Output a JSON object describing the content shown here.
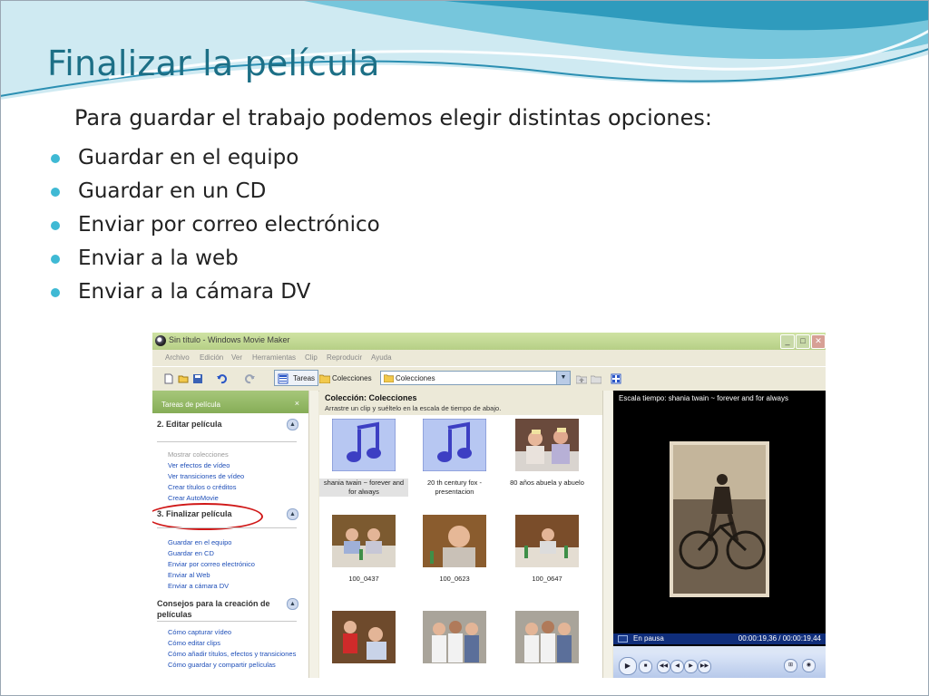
{
  "slide": {
    "title": "Finalizar la película",
    "intro": "Para guardar el trabajo podemos elegir distintas opciones:",
    "bullets": [
      "Guardar en el equipo",
      "Guardar en un CD",
      "Enviar por correo electrónico",
      "Enviar a la web",
      "Enviar a la cámara DV"
    ],
    "colors": {
      "title": "#1c6f86",
      "bullet_dot": "#3fb9d4",
      "highlight_oval": "#d01818"
    }
  },
  "window": {
    "title": "Sin título - Windows Movie Maker",
    "controls": {
      "minimize": "_",
      "maximize": "□",
      "close": "✕"
    },
    "menu": [
      "Archivo",
      "Edición",
      "Ver",
      "Herramientas",
      "Clip",
      "Reproducir",
      "Ayuda"
    ],
    "toolbar": {
      "tareas_label": "Tareas",
      "colecciones_label": "Colecciones",
      "combo_value": "Colecciones"
    },
    "tasks_pane": {
      "header": "Tareas de película",
      "close_glyph": "×",
      "sections": [
        {
          "title": "2. Editar película",
          "links": [
            "Mostrar colecciones",
            "Ver efectos de vídeo",
            "Ver transiciones de vídeo",
            "Crear títulos o créditos",
            "Crear AutoMovie"
          ]
        },
        {
          "title": "3. Finalizar película",
          "links": [
            "Guardar en el equipo",
            "Guardar en CD",
            "Enviar por correo electrónico",
            "Enviar al Web",
            "Enviar a cámara DV"
          ]
        },
        {
          "title": "Consejos para la creación de películas",
          "links": [
            "Cómo capturar vídeo",
            "Cómo editar clips",
            "Cómo añadir títulos, efectos y transiciones",
            "Cómo guardar y compartir películas"
          ]
        }
      ]
    },
    "collection": {
      "title": "Colección: Colecciones",
      "subtitle": "Arrastre un clip y suéltelo en la escala de tiempo de abajo.",
      "clips": [
        "shania twain ~ forever and for always",
        "20 th century fox - presentacion",
        "80 años abuela y abuelo",
        "100_0437",
        "100_0623",
        "100_0647"
      ]
    },
    "preview": {
      "title": "Escala tiempo: shania twain ~ forever and for always",
      "status": "En pausa",
      "time": "00:00:19,36 / 00:00:19,44"
    }
  }
}
